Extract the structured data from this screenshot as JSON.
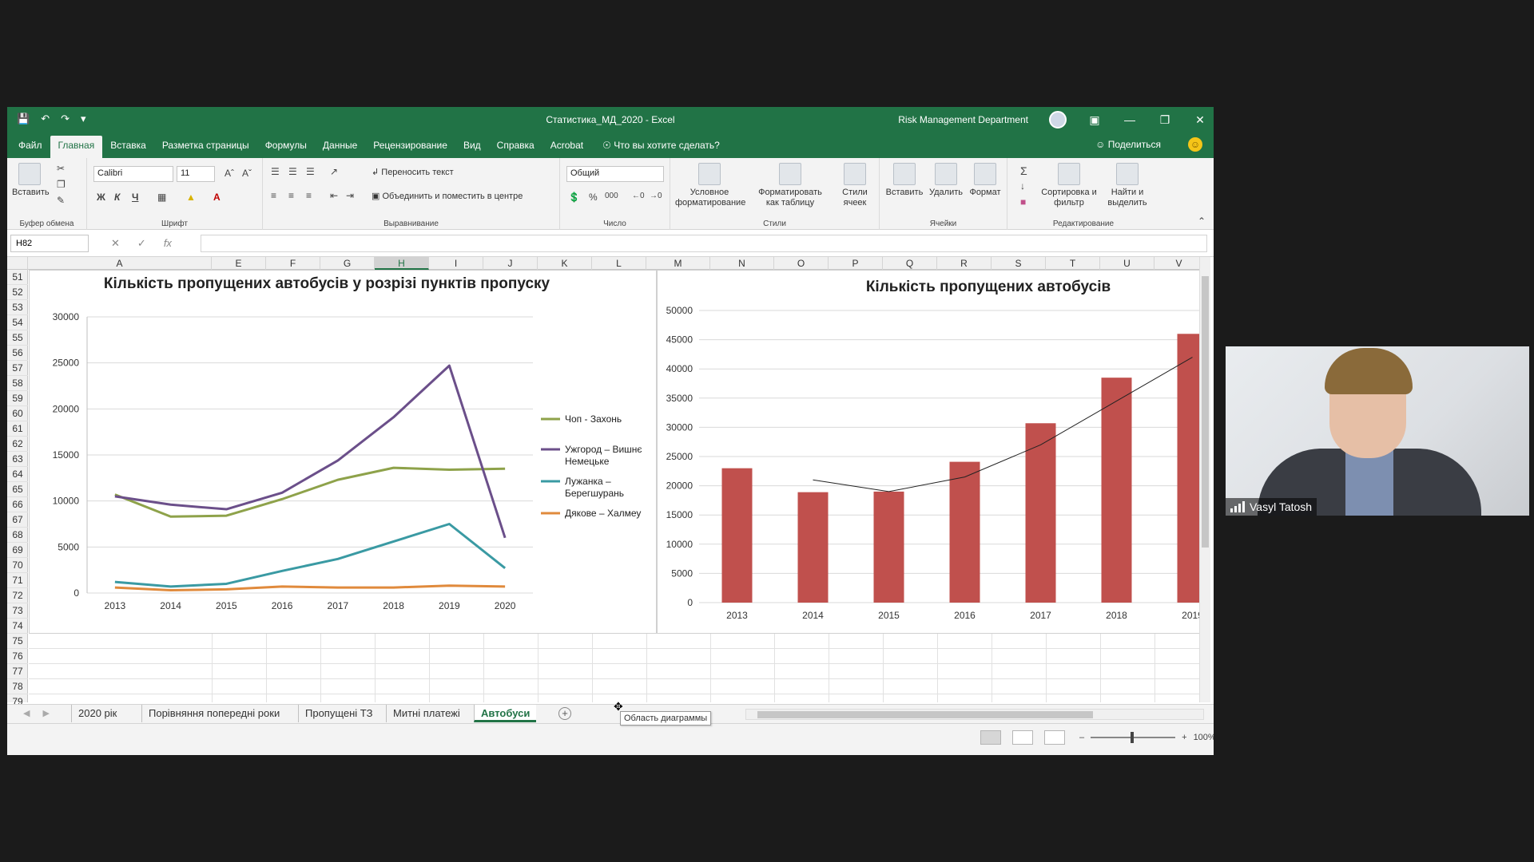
{
  "window": {
    "title": "Статистика_МД_2020  -  Excel",
    "account": "Risk Management Department"
  },
  "menu_tabs": [
    "Файл",
    "Главная",
    "Вставка",
    "Разметка страницы",
    "Формулы",
    "Данные",
    "Рецензирование",
    "Вид",
    "Справка",
    "Acrobat"
  ],
  "active_tab": "Главная",
  "tell_me": "Что вы хотите сделать?",
  "share": "Поделиться",
  "ribbon": {
    "clipboard": {
      "paste": "Вставить",
      "label": "Буфер обмена"
    },
    "font": {
      "name": "Calibri",
      "size": "11",
      "label": "Шрифт",
      "bold": "Ж",
      "italic": "К",
      "underline": "Ч"
    },
    "alignment": {
      "wrap": "Переносить текст",
      "merge": "Объединить и поместить в центре",
      "label": "Выравнивание"
    },
    "number": {
      "format": "Общий",
      "label": "Число"
    },
    "styles": {
      "conditional": "Условное форматирование",
      "as_table": "Форматировать как таблицу",
      "cell_styles": "Стили ячеек",
      "label": "Стили"
    },
    "cells": {
      "insert": "Вставить",
      "delete": "Удалить",
      "format": "Формат",
      "label": "Ячейки"
    },
    "editing": {
      "sort": "Сортировка и фильтр",
      "find": "Найти и выделить",
      "label": "Редактирование"
    }
  },
  "formula_bar": {
    "name_box": "H82",
    "fx": "fx",
    "value": ""
  },
  "columns": [
    "A",
    "E",
    "F",
    "G",
    "H",
    "I",
    "J",
    "K",
    "L",
    "M",
    "N",
    "O",
    "P",
    "Q",
    "R",
    "S",
    "T",
    "U",
    "V"
  ],
  "selected_column": "H",
  "rows": [
    "51",
    "52",
    "53",
    "54",
    "55",
    "56",
    "57",
    "58",
    "59",
    "60",
    "61",
    "62",
    "63",
    "64",
    "65",
    "66",
    "67",
    "68",
    "69",
    "70",
    "71",
    "72",
    "73",
    "74",
    "75",
    "76",
    "77",
    "78",
    "79"
  ],
  "chart_data": [
    {
      "type": "line",
      "title": "Кількість пропущених автобусів у розрізі пунктів пропуску",
      "categories": [
        "2013",
        "2014",
        "2015",
        "2016",
        "2017",
        "2018",
        "2019",
        "2020"
      ],
      "ylim": [
        0,
        30000
      ],
      "yticks": [
        "0",
        "5000",
        "10000",
        "15000",
        "20000",
        "25000",
        "30000"
      ],
      "grid": true,
      "legend": "right",
      "series": [
        {
          "name": "Чоп - Захонь",
          "color": "#8ea24a",
          "values": [
            10700,
            8300,
            8400,
            10200,
            12300,
            13600,
            13400,
            13500
          ]
        },
        {
          "name": "Ужгород – Вишнє Немецьке",
          "color": "#6b4f8a",
          "values": [
            10500,
            9600,
            9100,
            10900,
            14400,
            19100,
            24700,
            6000
          ]
        },
        {
          "name": "Лужанка – Берегшурань",
          "color": "#3a9aa3",
          "values": [
            1200,
            700,
            1000,
            2400,
            3700,
            5600,
            7500,
            2700
          ]
        },
        {
          "name": "Дякове – Халмеу",
          "color": "#e08a3c",
          "values": [
            600,
            300,
            400,
            700,
            600,
            600,
            800,
            700
          ]
        }
      ]
    },
    {
      "type": "bar",
      "title": "Кількість пропущених автобусів",
      "categories": [
        "2013",
        "2014",
        "2015",
        "2016",
        "2017",
        "2018",
        "2019"
      ],
      "values": [
        23000,
        18900,
        19000,
        24100,
        30700,
        38500,
        46000
      ],
      "ylim": [
        0,
        50000
      ],
      "yticks": [
        "0",
        "5000",
        "10000",
        "15000",
        "20000",
        "25000",
        "30000",
        "35000",
        "40000",
        "45000",
        "50000"
      ],
      "grid": true,
      "bar_color": "#c0504d",
      "trendline": [
        21000,
        19000,
        21500,
        27000,
        34500,
        42000
      ]
    }
  ],
  "sheets": [
    "2020 рік",
    "Порівняння попередні роки",
    "Пропущені ТЗ",
    "Митні платежі",
    "Автобуси"
  ],
  "active_sheet": "Автобуси",
  "tooltip": "Область диаграммы",
  "zoom": "100%",
  "webcam": {
    "name": "Vasyl Tatosh"
  }
}
